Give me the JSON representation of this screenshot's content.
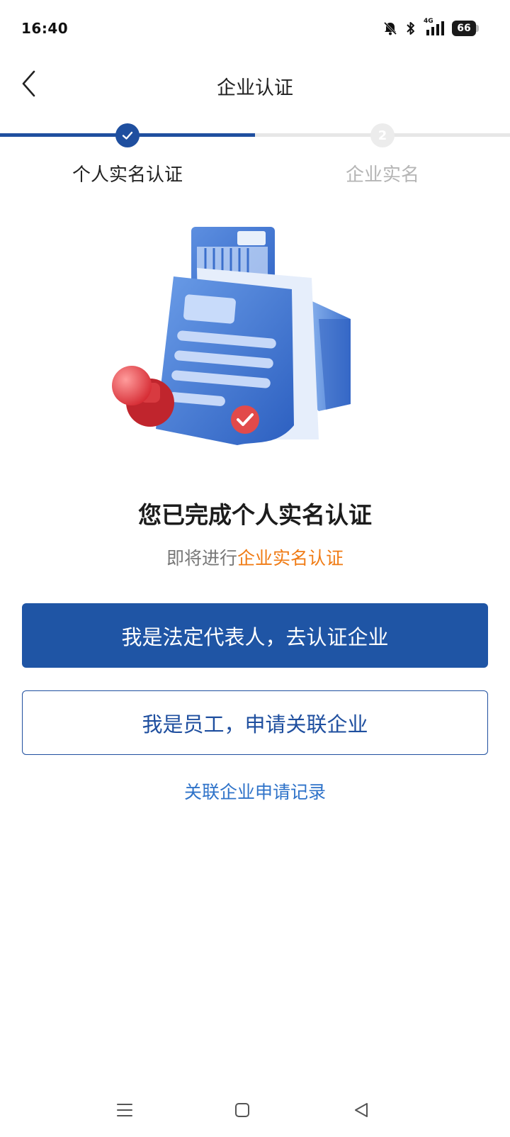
{
  "status_bar": {
    "time": "16:40",
    "network": "4G",
    "battery": "66"
  },
  "header": {
    "title": "企业认证"
  },
  "stepper": {
    "steps": [
      {
        "label": "个人实名认证",
        "state": "done"
      },
      {
        "label": "企业实名",
        "number": "2",
        "state": "pending"
      }
    ]
  },
  "content": {
    "headline": "您已完成个人实名认证",
    "subline_prefix": "即将进行",
    "subline_highlight": "企业实名认证"
  },
  "actions": {
    "primary_label": "我是法定代表人，去认证企业",
    "secondary_label": "我是员工，申请关联企业",
    "link_label": "关联企业申请记录"
  },
  "colors": {
    "primary": "#1f55a5",
    "accent_orange": "#f07b14",
    "link": "#2f73c9"
  },
  "icons": {
    "back": "chevron-left-icon",
    "done": "check-icon",
    "nav_menu": "menu-icon",
    "nav_home": "square-icon",
    "nav_back": "triangle-back-icon"
  }
}
